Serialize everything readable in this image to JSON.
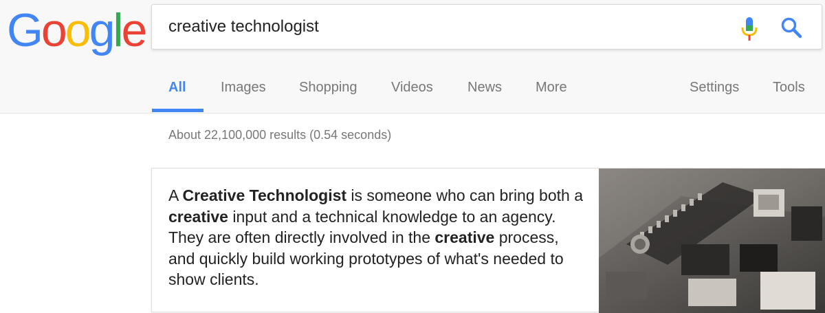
{
  "logo": {
    "letters": [
      {
        "char": "G",
        "color": "#4285f4"
      },
      {
        "char": "o",
        "color": "#ea4335"
      },
      {
        "char": "o",
        "color": "#fbbc05"
      },
      {
        "char": "g",
        "color": "#4285f4"
      },
      {
        "char": "l",
        "color": "#34a853"
      },
      {
        "char": "e",
        "color": "#ea4335"
      }
    ]
  },
  "search": {
    "query": "creative technologist",
    "mic_icon": "mic-icon",
    "search_icon": "search-icon"
  },
  "tabs": [
    {
      "label": "All",
      "active": true
    },
    {
      "label": "Images"
    },
    {
      "label": "Shopping"
    },
    {
      "label": "Videos"
    },
    {
      "label": "News"
    },
    {
      "label": "More"
    },
    {
      "label": "Settings"
    },
    {
      "label": "Tools"
    }
  ],
  "results": {
    "stats": "About 22,100,000 results (0.54 seconds)"
  },
  "featured_snippet": {
    "segments": [
      {
        "text": "A ",
        "bold": false
      },
      {
        "text": "Creative Technologist",
        "bold": true
      },
      {
        "text": " is someone who can bring both a ",
        "bold": false
      },
      {
        "text": "creative",
        "bold": true
      },
      {
        "text": " input and a technical knowledge to an agency. They are often directly involved in the ",
        "bold": false
      },
      {
        "text": "creative",
        "bold": true
      },
      {
        "text": " process, and quickly build working prototypes of what's needed to show clients.",
        "bold": false
      }
    ]
  },
  "colors": {
    "accent": "#4285f4",
    "header_bg": "#f8f8f8",
    "muted_text": "#777777"
  }
}
